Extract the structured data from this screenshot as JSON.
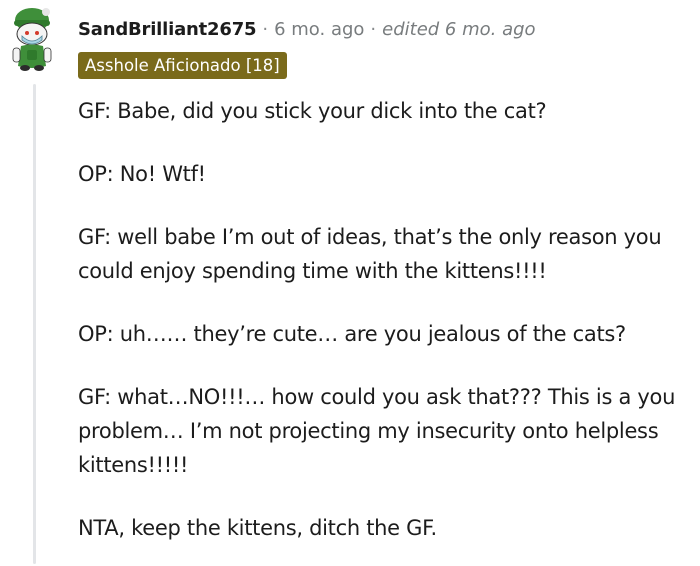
{
  "comment": {
    "username": "SandBrilliant2675",
    "separator": "·",
    "timestamp": "6 mo. ago",
    "edited": "edited 6 mo. ago",
    "flair": "Asshole Aficionado [18]",
    "flair_color": "#7a6a1b",
    "avatar_icon": "snoo-avatar-green-hat-icon",
    "paragraphs": [
      "GF: Babe, did you stick your dick into the cat?",
      "OP: No! Wtf!",
      "GF: well babe I’m out of ideas, that’s the only reason you could enjoy spending time with the kittens!!!!",
      "OP: uh…… they’re cute… are you jealous of the cats?",
      "GF: what…NO!!!… how could you ask that??? This is a you problem… I’m not projecting my insecurity onto helpless kittens!!!!!",
      "NTA, keep the kittens, ditch the GF."
    ]
  }
}
